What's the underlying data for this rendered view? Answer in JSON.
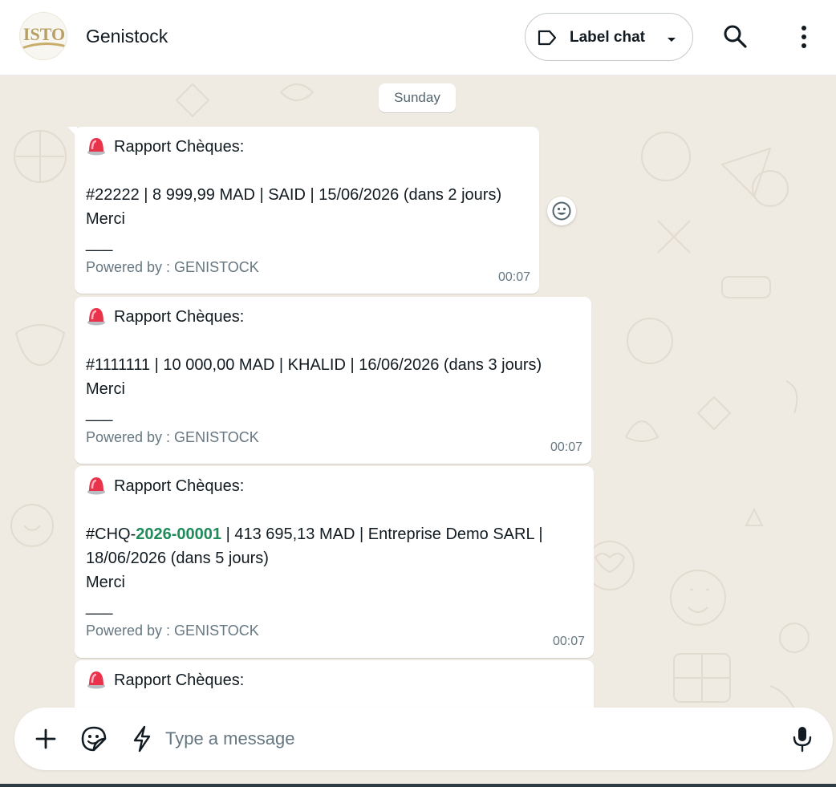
{
  "header": {
    "contact_name": "Genistock",
    "avatar_text": "ISTO",
    "label_button": "Label chat"
  },
  "chat": {
    "day_label": "Sunday",
    "messages": [
      {
        "title": "Rapport Chèques:",
        "body": "#22222 | 8 999,99 MAD | SAID | 15/06/2026 (dans 2 jours)",
        "thanks": "Merci",
        "separator": "___",
        "footer": "Powered by : GENISTOCK",
        "time": "00:07"
      },
      {
        "title": "Rapport Chèques:",
        "body": "#1111111 | 10 000,00 MAD | KHALID | 16/06/2026 (dans 3 jours)",
        "thanks": "Merci",
        "separator": "___",
        "footer": "Powered by : GENISTOCK",
        "time": "00:07"
      },
      {
        "title": "Rapport Chèques:",
        "body_prefix": "#CHQ-",
        "body_link": "2026-00001",
        "body_rest": " | 413 695,13 MAD | Entreprise Demo SARL |",
        "body_line2": "18/06/2026 (dans 5 jours)",
        "thanks": "Merci",
        "separator": "___",
        "footer": "Powered by : GENISTOCK",
        "time": "00:07"
      },
      {
        "title": "Rapport Chèques:"
      }
    ]
  },
  "composer": {
    "placeholder": "Type a message"
  },
  "icons": {
    "tag": "label-tag-icon",
    "caret": "chevron-down-icon",
    "search": "search-icon",
    "menu": "more-vertical-icon",
    "alarm": "siren-emoji",
    "react": "smiley-icon",
    "plus": "plus-icon",
    "sticker": "sticker-icon",
    "bolt": "lightning-icon",
    "mic": "microphone-icon"
  },
  "colors": {
    "chat_bg": "#efeae2",
    "bubble_bg": "#ffffff",
    "link_green": "#1f8a5a",
    "meta_gray": "#667781"
  }
}
